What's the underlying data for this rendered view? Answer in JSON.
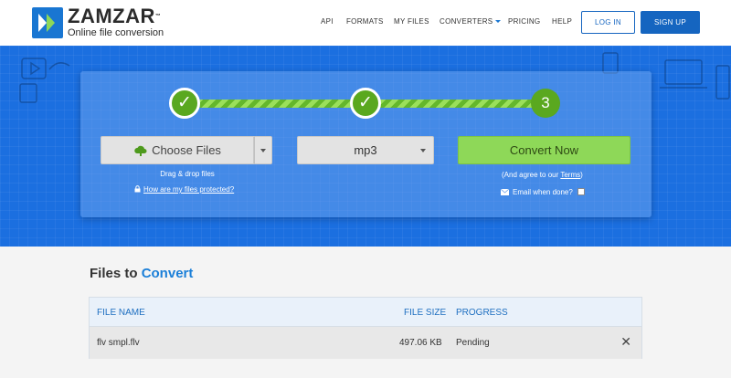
{
  "brand": {
    "name": "ZAMZAR",
    "tm": "™",
    "tagline": "Online file conversion"
  },
  "nav": {
    "items": [
      {
        "label": "API"
      },
      {
        "label": "FORMATS"
      },
      {
        "label": "MY FILES"
      },
      {
        "label": "CONVERTERS",
        "has_dropdown": true
      },
      {
        "label": "PRICING"
      },
      {
        "label": "HELP"
      }
    ],
    "login_label": "LOG IN",
    "signup_label": "SIGN UP"
  },
  "steps": [
    {
      "state": "done",
      "symbol": "✓"
    },
    {
      "state": "done",
      "symbol": "✓"
    },
    {
      "state": "current",
      "symbol": "3"
    }
  ],
  "converter": {
    "choose_files_label": "Choose Files",
    "drag_drop_text": "Drag & drop files",
    "protected_link": "How are my files protected?",
    "format_value": "mp3",
    "convert_label": "Convert Now",
    "agree_prefix": "(And agree to our ",
    "agree_link": "Terms",
    "agree_suffix": ")",
    "email_label": "Email when done?",
    "email_checked": false
  },
  "files": {
    "title_prefix": "Files to ",
    "title_highlight": "Convert",
    "columns": {
      "name": "FILE NAME",
      "size": "FILE SIZE",
      "progress": "PROGRESS"
    },
    "rows": [
      {
        "name": "flv smpl.flv",
        "size": "497.06 KB",
        "progress": "Pending",
        "remove": "✕"
      }
    ]
  },
  "colors": {
    "brand_blue": "#1565c0",
    "hero_blue": "#1b6fe0",
    "step_green": "#5aa81f",
    "convert_green": "#8ed858",
    "link_blue": "#1b7fd8"
  }
}
